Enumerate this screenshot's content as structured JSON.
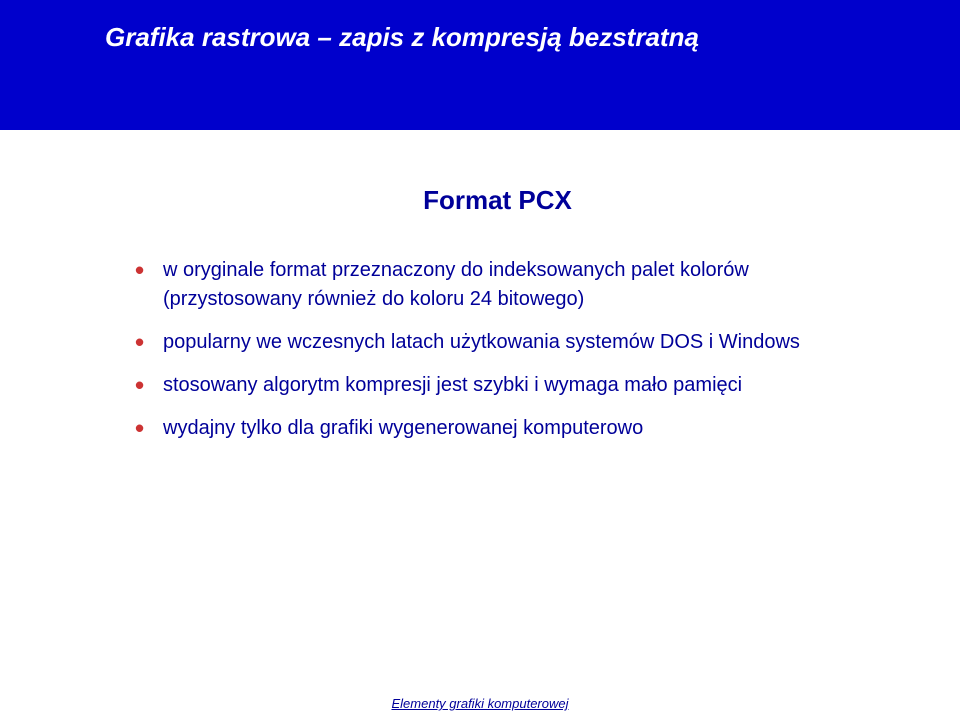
{
  "header": {
    "title": "Grafika rastrowa – zapis z kompresją bezstratną"
  },
  "content": {
    "heading": "Format PCX",
    "bullets": [
      "w oryginale format przeznaczony do indeksowanych palet kolorów (przystosowany również do koloru 24 bitowego)",
      "popularny we wczesnych latach użytkowania systemów DOS i Windows",
      "stosowany algorytm kompresji jest szybki i wymaga mało pamięci",
      "wydajny tylko dla grafiki wygenerowanej komputerowo"
    ]
  },
  "footer": {
    "text": "Elementy grafiki komputerowej"
  }
}
